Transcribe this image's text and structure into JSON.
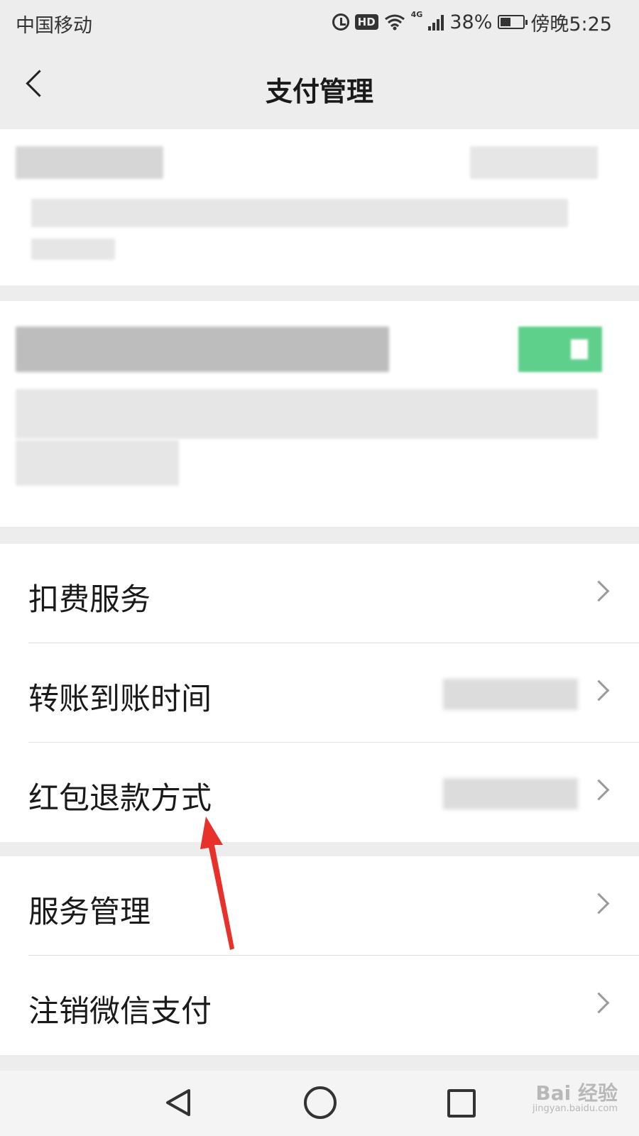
{
  "status_bar": {
    "carrier": "中国移动",
    "hd_badge": "HD",
    "network": "4G",
    "battery": "38%",
    "time": "傍晚5:25"
  },
  "nav": {
    "title": "支付管理"
  },
  "menu": {
    "group1": [
      {
        "label": "扣费服务"
      },
      {
        "label": "转账到账时间"
      },
      {
        "label": "红包退款方式"
      }
    ],
    "group2": [
      {
        "label": "服务管理"
      },
      {
        "label": "注销微信支付"
      }
    ]
  },
  "watermark": {
    "brand": "Bai 经验",
    "url": "jingyan.baidu.com"
  },
  "colors": {
    "background": "#ededed",
    "card": "#ffffff",
    "toggle_green": "#07c160",
    "annotation_red": "#e8312a"
  },
  "icons": {
    "back": "chevron-left-icon",
    "row_arrow": "chevron-right-icon",
    "system_back": "triangle-back-icon",
    "system_home": "circle-home-icon",
    "system_recent": "square-recent-icon"
  }
}
